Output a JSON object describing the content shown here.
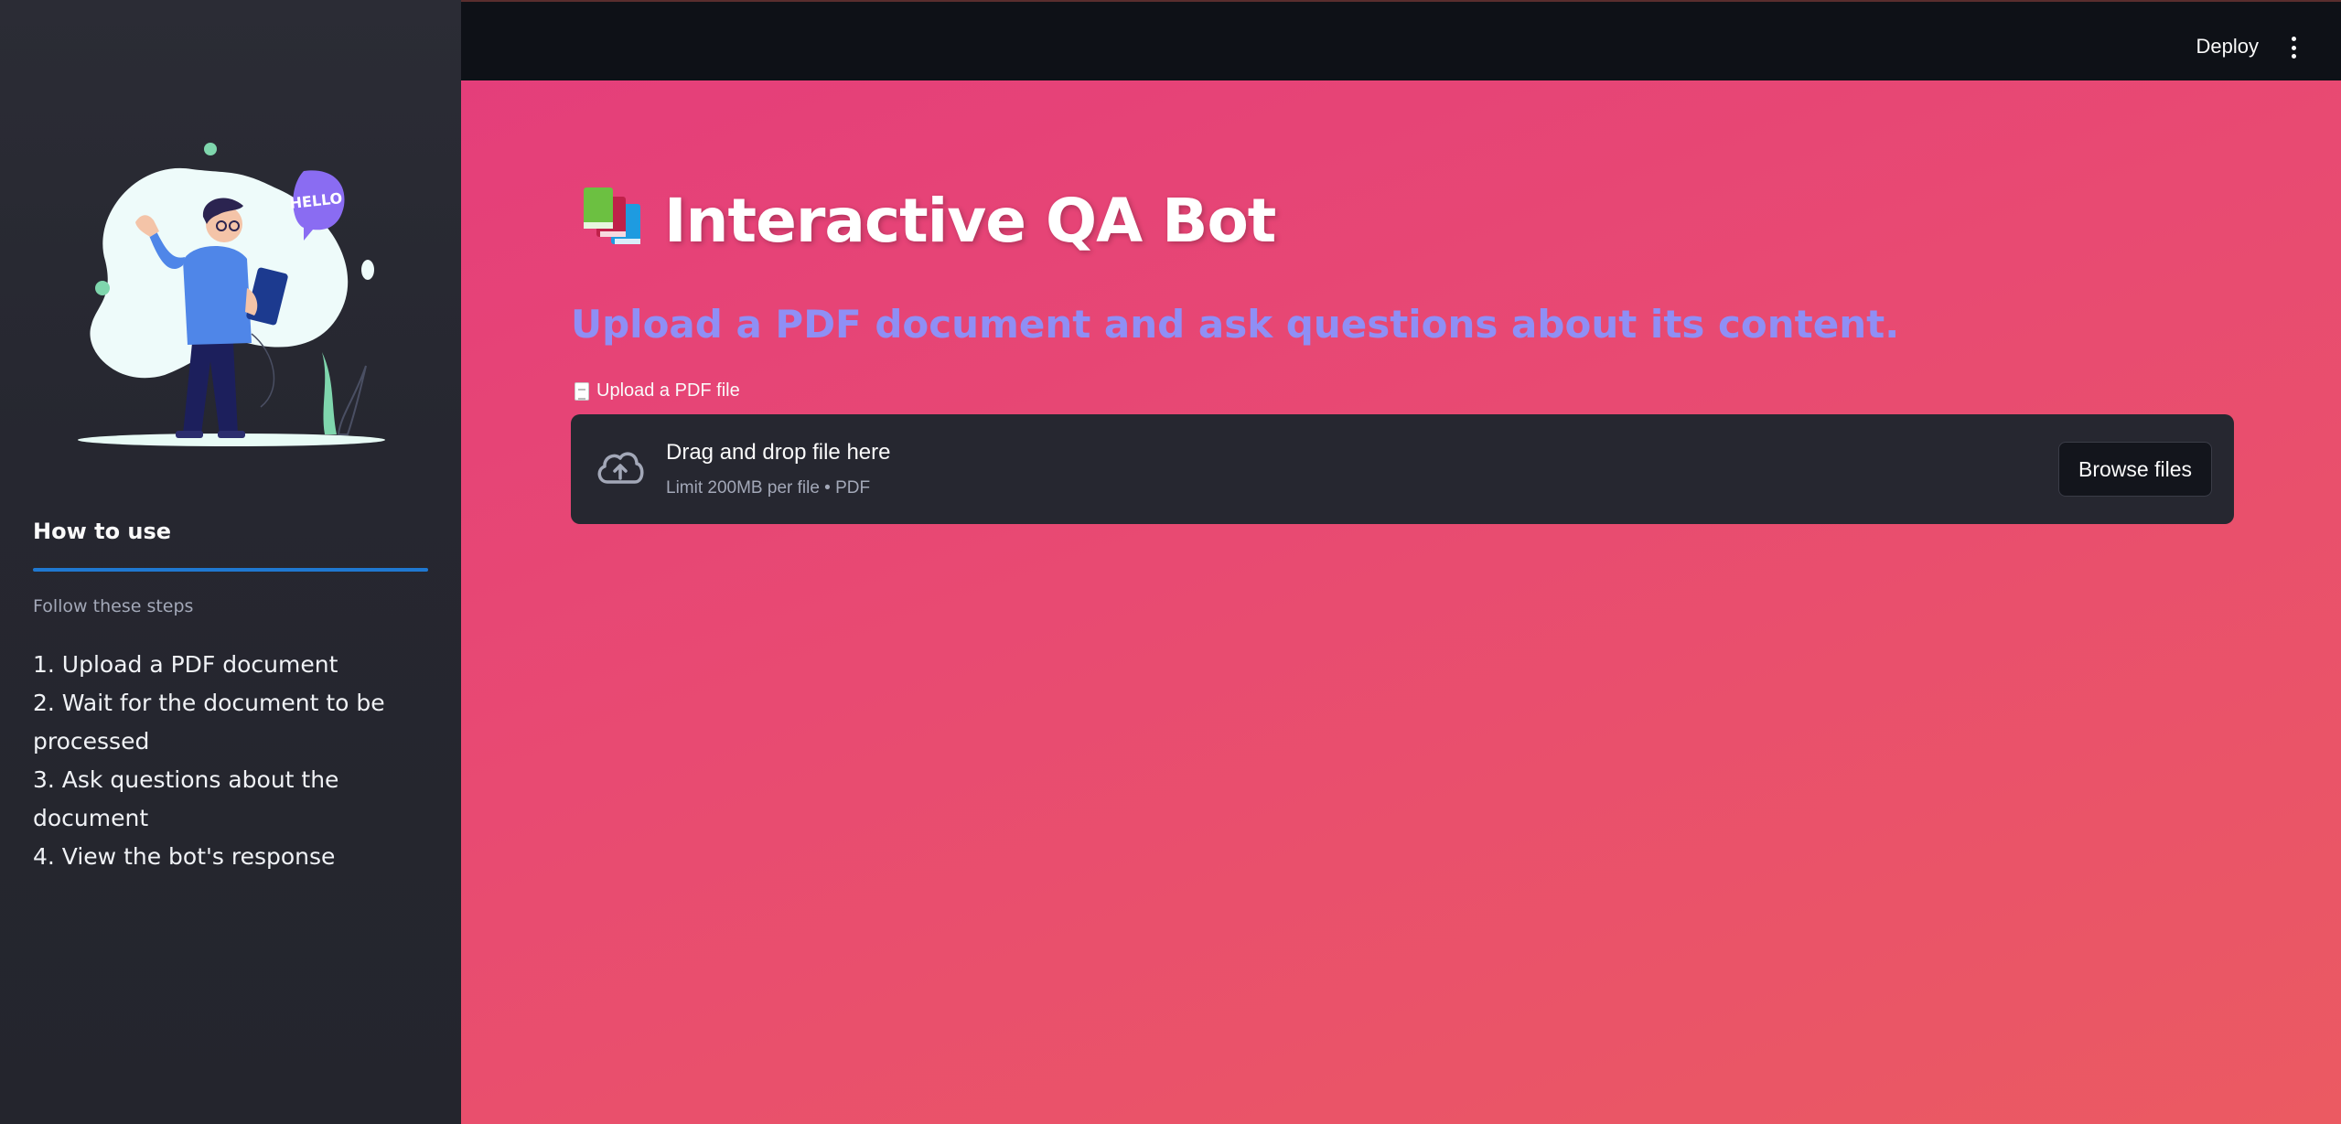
{
  "header": {
    "deploy_label": "Deploy",
    "menu_icon": "more-vertical-icon"
  },
  "sidebar": {
    "illustration_text": "HELLO",
    "heading": "How to use",
    "caption": "Follow these steps",
    "steps": [
      "1. Upload a PDF document",
      "2. Wait for the document to be processed",
      "3. Ask questions about the document",
      "4. View the bot's response"
    ]
  },
  "main": {
    "title_icon": "books-icon",
    "title": "Interactive QA Bot",
    "subtitle": "Upload a PDF document and ask questions about its content.",
    "uploader": {
      "label_icon": "document-icon",
      "label": "Upload a PDF file",
      "drop_title": "Drag and drop file here",
      "drop_limit": "Limit 200MB per file • PDF",
      "browse_label": "Browse files"
    }
  },
  "colors": {
    "sidebar_bg": "#262730",
    "topbar_bg": "#0e1117",
    "main_gradient_start": "#e43d7b",
    "main_gradient_end": "#eb5a62",
    "subtitle": "#8f8ff5",
    "accent_rule": "#1f78d1",
    "dropzone_bg": "#262730"
  }
}
